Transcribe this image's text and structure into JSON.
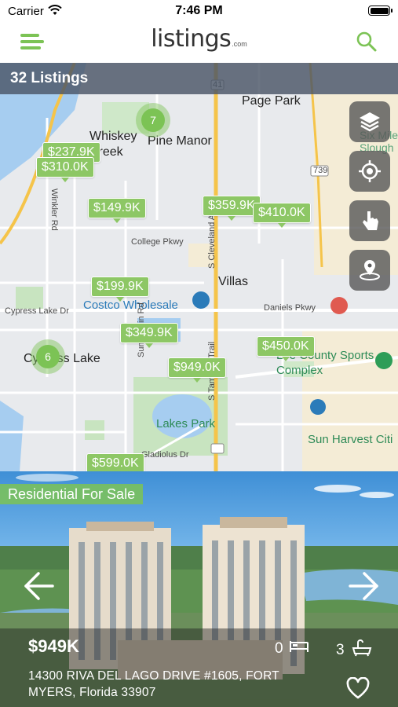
{
  "status_bar": {
    "carrier": "Carrier",
    "time": "7:46 PM"
  },
  "header": {
    "logo_text": "listings",
    "logo_suffix": ".com",
    "brand_color": "#7cc355"
  },
  "map": {
    "listing_count": "32 Listings",
    "clusters": [
      {
        "count": "7"
      },
      {
        "count": "6"
      }
    ],
    "price_markers": [
      "$237.9K",
      "$310.0K",
      "$149.9K",
      "$359.9K",
      "$410.0K",
      "$199.9K",
      "$349.9K",
      "$949.0K",
      "$450.0K",
      "$599.0K"
    ],
    "place_labels": [
      "Page Park",
      "Whiskey Creek",
      "Pine Manor",
      "Villas",
      "Cypress Lake",
      "Lakes Park",
      "Six Mile Slough"
    ],
    "poi_labels": [
      "Costco Wholesale",
      "Lee County Sports Complex",
      "Sun Harvest Citi"
    ],
    "road_labels": [
      "College Pkwy",
      "Daniels Pkwy",
      "Cypress Lake Dr",
      "Winkler Rd",
      "Summerlin Rd",
      "S Cleveland Ave",
      "S Tamiami Trail",
      "Gladiolus Dr",
      "739",
      "41"
    ],
    "tools": [
      "layers-icon",
      "locate-icon",
      "draw-icon",
      "pin-area-icon"
    ]
  },
  "listing": {
    "status": "Residential For Sale",
    "price": "$949K",
    "beds": "0",
    "baths": "3",
    "address": "14300 RIVA DEL LAGO DRIVE #1605, FORT MYERS, Florida 33907"
  }
}
